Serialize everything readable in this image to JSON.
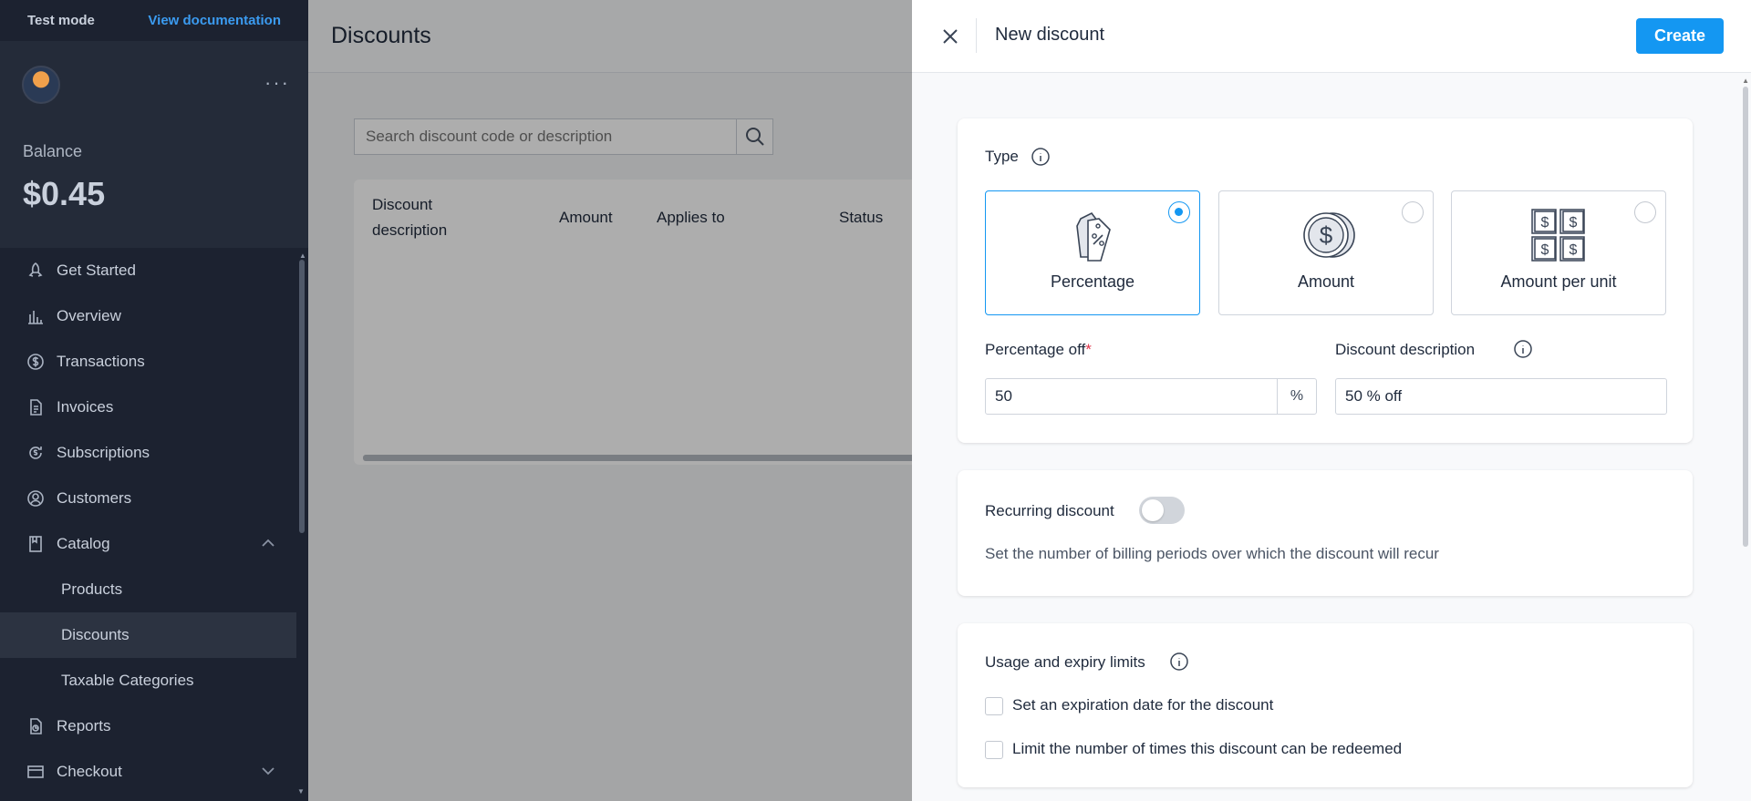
{
  "sidebar": {
    "test_mode": "Test mode",
    "view_docs": "View documentation",
    "balance_label": "Balance",
    "balance_value": "$0.45",
    "items": [
      {
        "label": "Get Started",
        "icon": "rocket-icon"
      },
      {
        "label": "Overview",
        "icon": "bar-chart-icon"
      },
      {
        "label": "Transactions",
        "icon": "dollar-circle-icon"
      },
      {
        "label": "Invoices",
        "icon": "invoice-icon"
      },
      {
        "label": "Subscriptions",
        "icon": "subscription-icon"
      },
      {
        "label": "Customers",
        "icon": "user-circle-icon"
      },
      {
        "label": "Catalog",
        "icon": "catalog-icon"
      },
      {
        "label": "Products"
      },
      {
        "label": "Discounts"
      },
      {
        "label": "Taxable Categories"
      },
      {
        "label": "Reports",
        "icon": "report-icon"
      },
      {
        "label": "Checkout",
        "icon": "checkout-icon"
      }
    ]
  },
  "main": {
    "title": "Discounts",
    "search_placeholder": "Search discount code or description",
    "columns": [
      "Discount description",
      "Amount",
      "Applies to",
      "Status"
    ]
  },
  "drawer": {
    "title": "New discount",
    "create_label": "Create",
    "type_label": "Type",
    "type_options": [
      {
        "label": "Percentage",
        "selected": true
      },
      {
        "label": "Amount",
        "selected": false
      },
      {
        "label": "Amount per unit",
        "selected": false
      }
    ],
    "percentage_label": "Percentage off",
    "required_mark": "*",
    "percentage_value": "50",
    "percentage_suffix": "%",
    "description_label": "Discount description",
    "description_value": "50 % off",
    "recurring_label": "Recurring discount",
    "recurring_on": false,
    "recurring_desc": "Set the number of billing periods over which the discount will recur",
    "limits_label": "Usage and expiry limits",
    "expiry_label": "Set an expiration date for the discount",
    "redeem_label": "Limit the number of times this discount can be redeemed"
  },
  "colors": {
    "accent": "#1497f2",
    "sidebar_bg": "#1c2230",
    "required": "#e0344a"
  }
}
